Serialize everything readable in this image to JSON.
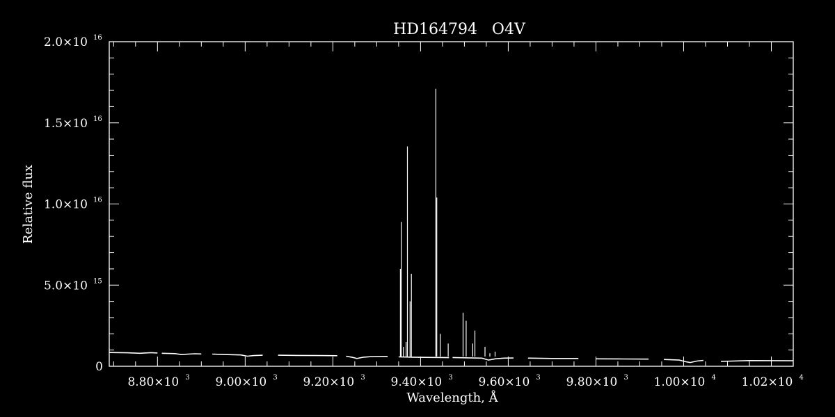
{
  "chart_data": {
    "type": "line",
    "title": "HD164794   O4V",
    "xlabel": "Wavelength, Å",
    "ylabel": "Relative flux",
    "xlim": [
      8690,
      10250
    ],
    "ylim": [
      0,
      2e+16
    ],
    "grid": false,
    "x_ticks": [
      {
        "value": 8800,
        "mantissa": "8.80",
        "exp": "3"
      },
      {
        "value": 9000,
        "mantissa": "9.00",
        "exp": "3"
      },
      {
        "value": 9200,
        "mantissa": "9.20",
        "exp": "3"
      },
      {
        "value": 9400,
        "mantissa": "9.40",
        "exp": "3"
      },
      {
        "value": 9600,
        "mantissa": "9.60",
        "exp": "3"
      },
      {
        "value": 9800,
        "mantissa": "9.80",
        "exp": "3"
      },
      {
        "value": 10000,
        "mantissa": "1.00",
        "exp": "4"
      },
      {
        "value": 10200,
        "mantissa": "1.02",
        "exp": "4"
      }
    ],
    "y_ticks": [
      {
        "value": 0,
        "mantissa": "0",
        "exp": ""
      },
      {
        "value": 5000000000000000.0,
        "mantissa": "5.0",
        "exp": "15"
      },
      {
        "value": 1e+16,
        "mantissa": "1.0",
        "exp": "16"
      },
      {
        "value": 1.5e+16,
        "mantissa": "1.5",
        "exp": "16"
      },
      {
        "value": 2e+16,
        "mantissa": "2.0",
        "exp": "16"
      }
    ],
    "series": [
      {
        "segments": [
          {
            "x": [
              8690,
              8730,
              8760,
              8785,
              8800
            ],
            "y": [
              850000000000000.0,
              830000000000000.0,
              800000000000000.0,
              840000000000000.0,
              820000000000000.0
            ]
          },
          {
            "x": [
              8810,
              8840,
              8855,
              8870,
              8885,
              8900
            ],
            "y": [
              800000000000000.0,
              780000000000000.0,
              720000000000000.0,
              750000000000000.0,
              770000000000000.0,
              760000000000000.0
            ]
          },
          {
            "x": [
              8925,
              8960,
              8990,
              9005,
              9020,
              9040
            ],
            "y": [
              750000000000000.0,
              720000000000000.0,
              700000000000000.0,
              620000000000000.0,
              660000000000000.0,
              680000000000000.0
            ]
          },
          {
            "x": [
              9075,
              9120,
              9170,
              9210
            ],
            "y": [
              680000000000000.0,
              670000000000000.0,
              660000000000000.0,
              650000000000000.0
            ]
          },
          {
            "x": [
              9230,
              9245,
              9255,
              9270,
              9290,
              9325
            ],
            "y": [
              620000000000000.0,
              550000000000000.0,
              480000000000000.0,
              560000000000000.0,
              600000000000000.0,
              610000000000000.0
            ]
          },
          {
            "x": [
              9350,
              9380,
              9410,
              9450,
              9465
            ],
            "y": [
              580000000000000.0,
              560000000000000.0,
              550000000000000.0,
              540000000000000.0,
              530000000000000.0
            ]
          },
          {
            "x": [
              9473,
              9510,
              9540,
              9555,
              9570,
              9590,
              9612
            ],
            "y": [
              540000000000000.0,
              520000000000000.0,
              500000000000000.0,
              380000000000000.0,
              460000000000000.0,
              500000000000000.0,
              510000000000000.0
            ]
          },
          {
            "x": [
              9645,
              9700,
              9760
            ],
            "y": [
              500000000000000.0,
              480000000000000.0,
              480000000000000.0
            ]
          },
          {
            "x": [
              9800,
              9860,
              9920
            ],
            "y": [
              460000000000000.0,
              450000000000000.0,
              440000000000000.0
            ]
          },
          {
            "x": [
              9955,
              9990,
              10005,
              10015,
              10030,
              10045
            ],
            "y": [
              420000000000000.0,
              380000000000000.0,
              280000000000000.0,
              230000000000000.0,
              320000000000000.0,
              360000000000000.0
            ]
          },
          {
            "x": [
              10085,
              10150,
              10250
            ],
            "y": [
              300000000000000.0,
              350000000000000.0,
              340000000000000.0
            ]
          }
        ]
      }
    ],
    "spikes": [
      {
        "x": 9354,
        "y": 6000000000000000.0
      },
      {
        "x": 9356,
        "y": 8900000000000000.0
      },
      {
        "x": 9361,
        "y": 1200000000000000.0
      },
      {
        "x": 9367,
        "y": 1500000000000000.0
      },
      {
        "x": 9370,
        "y": 1.355e+16
      },
      {
        "x": 9376,
        "y": 4000000000000000.0
      },
      {
        "x": 9379,
        "y": 5700000000000000.0
      },
      {
        "x": 9435,
        "y": 1.71e+16
      },
      {
        "x": 9437,
        "y": 1.04e+16
      },
      {
        "x": 9445,
        "y": 2000000000000000.0
      },
      {
        "x": 9463,
        "y": 1400000000000000.0
      },
      {
        "x": 9497,
        "y": 3300000000000000.0
      },
      {
        "x": 9504,
        "y": 2800000000000000.0
      },
      {
        "x": 9519,
        "y": 1400000000000000.0
      },
      {
        "x": 9524,
        "y": 2200000000000000.0
      },
      {
        "x": 9547,
        "y": 1200000000000000.0
      },
      {
        "x": 9558,
        "y": 800000000000000.0
      },
      {
        "x": 9570,
        "y": 900000000000000.0
      }
    ]
  }
}
